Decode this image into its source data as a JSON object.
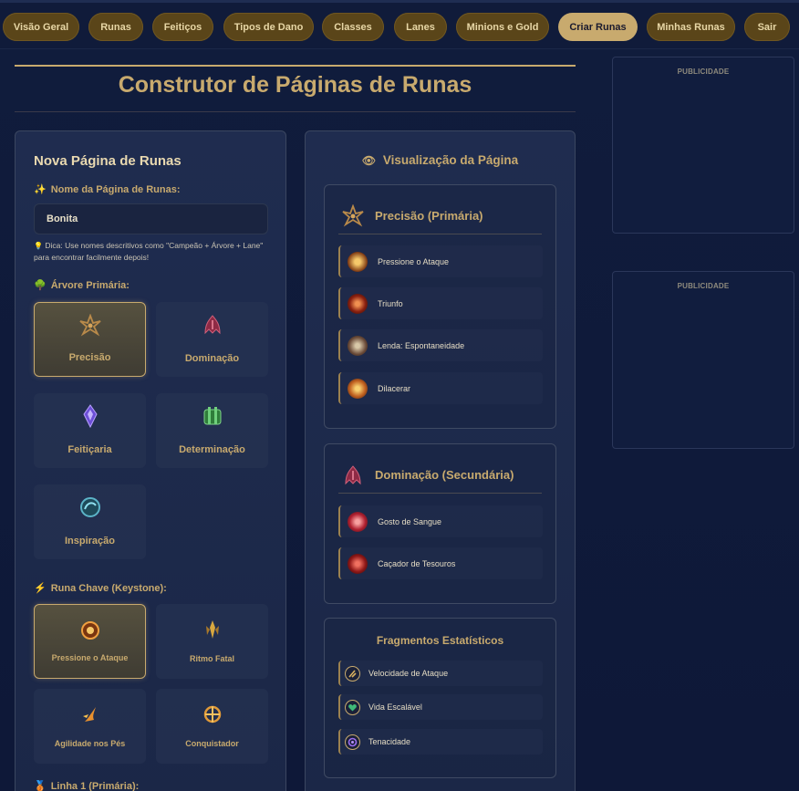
{
  "nav": {
    "items": [
      {
        "label": "Visão Geral"
      },
      {
        "label": "Runas"
      },
      {
        "label": "Feitiços"
      },
      {
        "label": "Tipos de Dano"
      },
      {
        "label": "Classes"
      },
      {
        "label": "Lanes"
      },
      {
        "label": "Minions e Gold"
      },
      {
        "label": "Criar Runas"
      },
      {
        "label": "Minhas Runas"
      },
      {
        "label": "Sair"
      }
    ],
    "active": "Criar Runas",
    "active_color": "#c8aa6e",
    "button_color": "#5a4519"
  },
  "page": {
    "title": "Construtor de Páginas de Runas"
  },
  "builder": {
    "title": "Nova Página de Runas",
    "name_label": "Nome da Página de Runas:",
    "name_label_icon": "✨",
    "name_value": "Bonita",
    "tip_icon": "💡",
    "tip_text": "Dica: Use nomes descritivos como \"Campeão + Árvore + Lane\" para encontrar facilmente depois!",
    "primary_tree_label": "Árvore Primária:",
    "primary_tree_icon": "🌳",
    "trees": [
      {
        "name": "Precisão",
        "icon": "precision-icon",
        "selected": true
      },
      {
        "name": "Dominação",
        "icon": "domination-icon",
        "selected": false
      },
      {
        "name": "Feitiçaria",
        "icon": "sorcery-icon",
        "selected": false
      },
      {
        "name": "Determinação",
        "icon": "resolve-icon",
        "selected": false
      },
      {
        "name": "Inspiração",
        "icon": "inspiration-icon",
        "selected": false
      }
    ],
    "keystone_label": "Runa Chave (Keystone):",
    "keystone_icon": "⚡",
    "keystones": [
      {
        "name": "Pressione o Ataque",
        "icon": "press-the-attack-icon",
        "selected": true
      },
      {
        "name": "Ritmo Fatal",
        "icon": "lethal-tempo-icon",
        "selected": false
      },
      {
        "name": "Agilidade nos Pés",
        "icon": "fleet-footwork-icon",
        "selected": false
      },
      {
        "name": "Conquistador",
        "icon": "conqueror-icon",
        "selected": false
      }
    ],
    "row1_label": "Linha 1 (Primária):",
    "row1_icon": "🥉"
  },
  "preview": {
    "title": "Visualização da Página",
    "title_icon": "👁",
    "primary": {
      "title": "Precisão (Primária)",
      "runes": [
        "Pressione o Ataque",
        "Triunfo",
        "Lenda: Espontaneidade",
        "Dilacerar"
      ]
    },
    "secondary": {
      "title": "Dominação (Secundária)",
      "runes": [
        "Gosto de Sangue",
        "Caçador de Tesouros"
      ]
    },
    "shards": {
      "title": "Fragmentos Estatísticos",
      "items": [
        "Velocidade de Ataque",
        "Vida Escalável",
        "Tenacidade"
      ]
    }
  },
  "ads": {
    "label": "PUBLICIDADE"
  }
}
